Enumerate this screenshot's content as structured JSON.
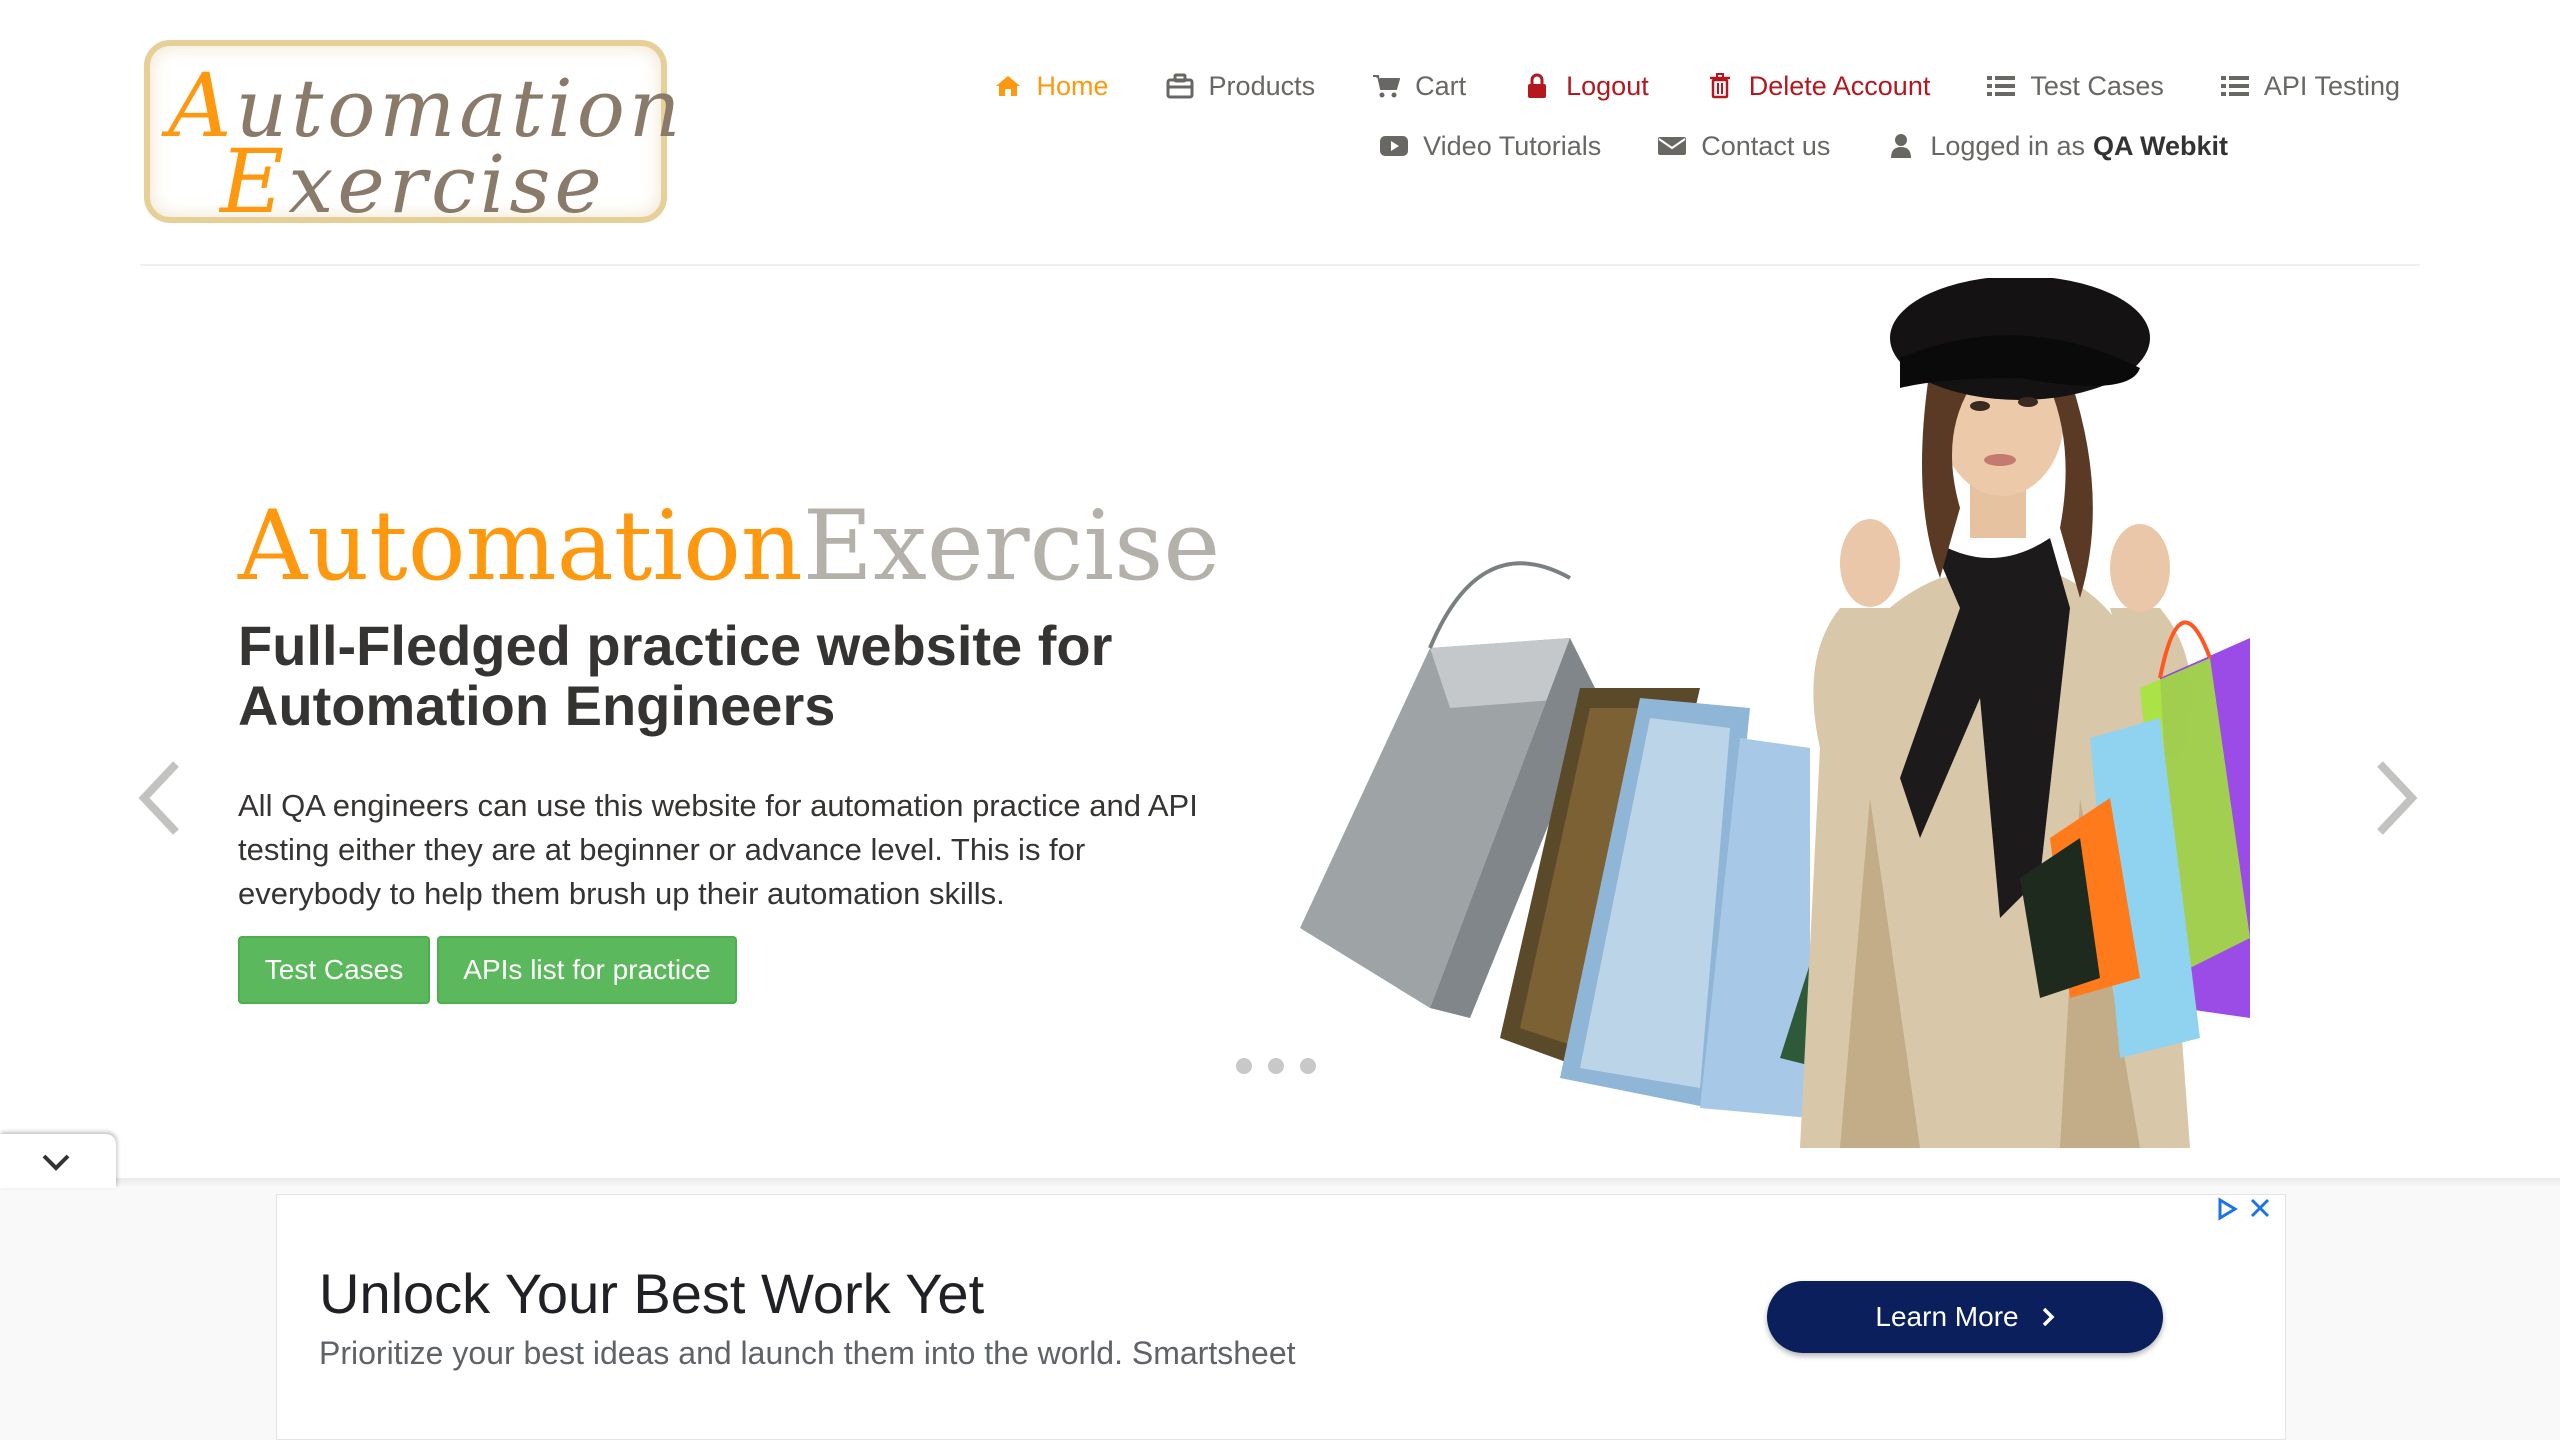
{
  "logo": {
    "line1": "Automation",
    "line2": "Exercise"
  },
  "nav": {
    "row1": [
      {
        "label": "Home",
        "icon": "home-icon",
        "state": "active"
      },
      {
        "label": "Products",
        "icon": "products-icon",
        "state": "normal"
      },
      {
        "label": "Cart",
        "icon": "cart-icon",
        "state": "normal"
      },
      {
        "label": "Logout",
        "icon": "lock-icon",
        "state": "danger"
      },
      {
        "label": "Delete Account",
        "icon": "trash-icon",
        "state": "danger"
      },
      {
        "label": "Test Cases",
        "icon": "list-icon",
        "state": "normal"
      },
      {
        "label": "API Testing",
        "icon": "list-icon",
        "state": "normal"
      }
    ],
    "row2": [
      {
        "label": "Video Tutorials",
        "icon": "youtube-icon"
      },
      {
        "label": "Contact us",
        "icon": "envelope-icon"
      },
      {
        "label": "Logged in as",
        "icon": "user-icon",
        "username": "QA Webkit"
      }
    ]
  },
  "slider": {
    "brand_part1": "Automation",
    "brand_part2": "Exercise",
    "headline": "Full-Fledged practice website for Automation Engineers",
    "description": "All QA engineers can use this website for automation practice and API testing either they are at beginner or advance level. This is for everybody to help them brush up their automation skills.",
    "btn_test_cases": "Test Cases",
    "btn_apis": "APIs list for practice",
    "slide_count": 3,
    "active_slide": 1
  },
  "ad": {
    "title": "Unlock Your Best Work Yet",
    "subtitle": "Prioritize your best ideas and launch them into the world. Smartsheet",
    "cta": "Learn More"
  },
  "colors": {
    "accent": "#fe980f",
    "danger": "#b5171e",
    "button_green": "#5cb85c",
    "ad_button": "#0a1f5c"
  }
}
